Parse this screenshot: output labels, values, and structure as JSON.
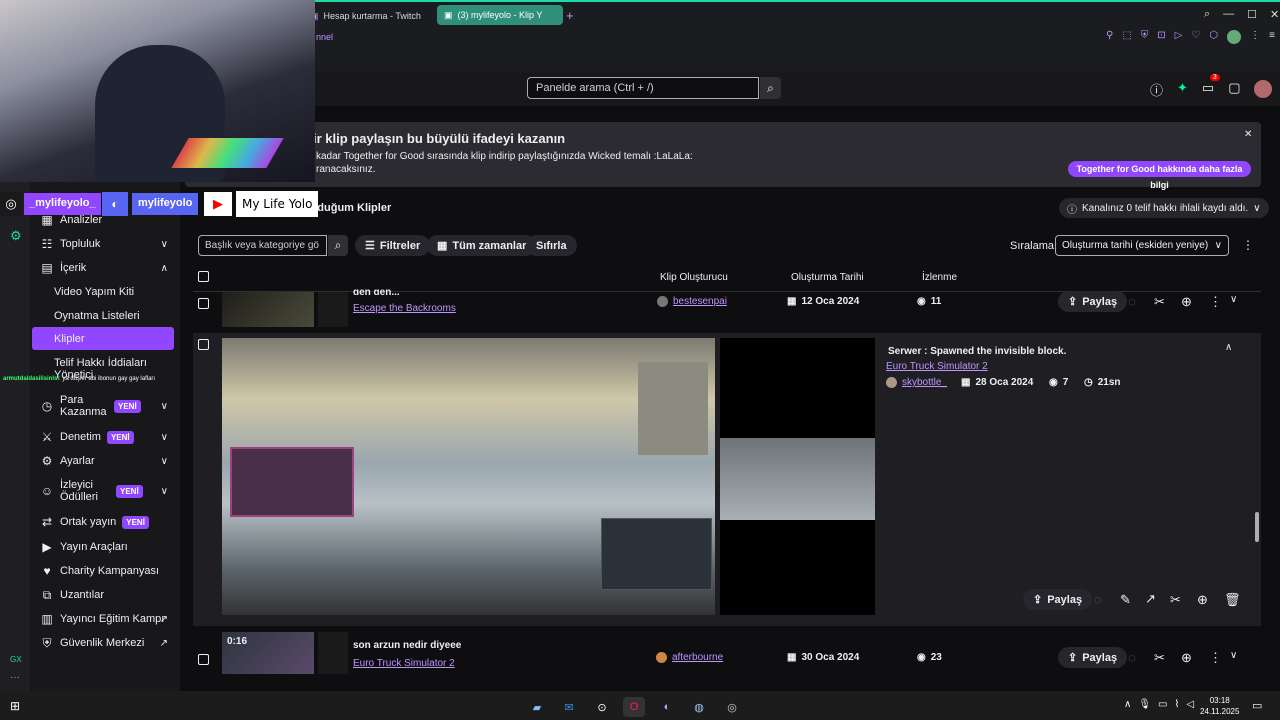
{
  "browser": {
    "tabs": [
      {
        "label": "Hesap kurtarma - Twitch"
      },
      {
        "label": "(3) mylifeyolo - Klip Y"
      }
    ],
    "tab_partial": "nnel",
    "notification_count": "3"
  },
  "search": {
    "placeholder": "Panelde arama (Ctrl + /)"
  },
  "banner": {
    "title": "ir klip paylaşın bu büyülü ifadeyi kazanın",
    "line1": "kadar Together for Good sırasında klip indirip paylaştığınızda Wicked temalı :LaLaLa:",
    "line2": "ranacaksınız.",
    "button": "Together for Good hakkında daha fazla bilgi"
  },
  "overlay": {
    "instagram": "_mylifeyolo_",
    "discord": "mylifeyolo",
    "youtube": "My Life Yolo",
    "chat_user": "armutdaldasilisinlsi",
    "chat_msg": ": ya düşler abi ibonun gay gay lafları"
  },
  "section": {
    "title": "rduğum Klipler",
    "notice": "Kanalınız 0 telif hakkı ihlali kaydı aldı."
  },
  "filters": {
    "search_placeholder": "Başlık veya kategoriye gö",
    "filters_label": "Filtreler",
    "time_label": "Tüm zamanlar",
    "reset_label": "Sıfırla",
    "sort_label": "Sıralama:",
    "sort_value": "Oluşturma tarihi (eskiden yeniye)"
  },
  "table": {
    "headers": {
      "creator": "Klip Oluşturucu",
      "date": "Oluşturma Tarihi",
      "views": "İzlenme"
    }
  },
  "clips": [
    {
      "title": "gen gen...",
      "category": "Escape the Backrooms",
      "creator": "bestesenpai",
      "date": "12 Oca 2024",
      "views": "11",
      "share": "Paylaş"
    },
    {
      "title": "Serwer : Spawned the invisible block.",
      "category": "Euro Truck Simulator 2",
      "creator": "skybottle_",
      "date": "28 Oca 2024",
      "views": "7",
      "duration": "21sn",
      "share": "Paylaş"
    },
    {
      "title": "son arzun nedir diyeee",
      "category": "Euro Truck Simulator 2",
      "creator": "afterbourne",
      "date": "30 Oca 2024",
      "views": "23",
      "duration": "0:16",
      "share": "Paylaş"
    }
  ],
  "sidebar": {
    "items": [
      {
        "label": "Analizler",
        "icon": "chart-icon"
      },
      {
        "label": "Topluluk",
        "icon": "community-icon"
      },
      {
        "label": "İçerik",
        "icon": "content-icon"
      },
      {
        "label": "Video Yapım Kiti"
      },
      {
        "label": "Oynatma Listeleri"
      },
      {
        "label": "Klipler"
      },
      {
        "label": "Telif Hakkı İddiaları Yönetici"
      },
      {
        "label": "Para Kazanma",
        "badge": "YENİ"
      },
      {
        "label": "Denetim",
        "badge": "YENİ"
      },
      {
        "label": "Ayarlar"
      },
      {
        "label": "İzleyici Ödülleri",
        "badge": "YENİ"
      },
      {
        "label": "Ortak yayın",
        "badge": "YENİ"
      },
      {
        "label": "Yayın Araçları"
      },
      {
        "label": "Charity Kampanyası"
      },
      {
        "label": "Uzantılar"
      },
      {
        "label": "Yayıncı Eğitim Kampı"
      },
      {
        "label": "Güvenlik Merkezi"
      }
    ]
  },
  "taskbar": {
    "time": "03:18",
    "date": "24.11.2025"
  },
  "colors": {
    "accent": "#9147ff",
    "link": "#bf94ff",
    "bg": "#0e0e10",
    "panel": "#18181b"
  }
}
